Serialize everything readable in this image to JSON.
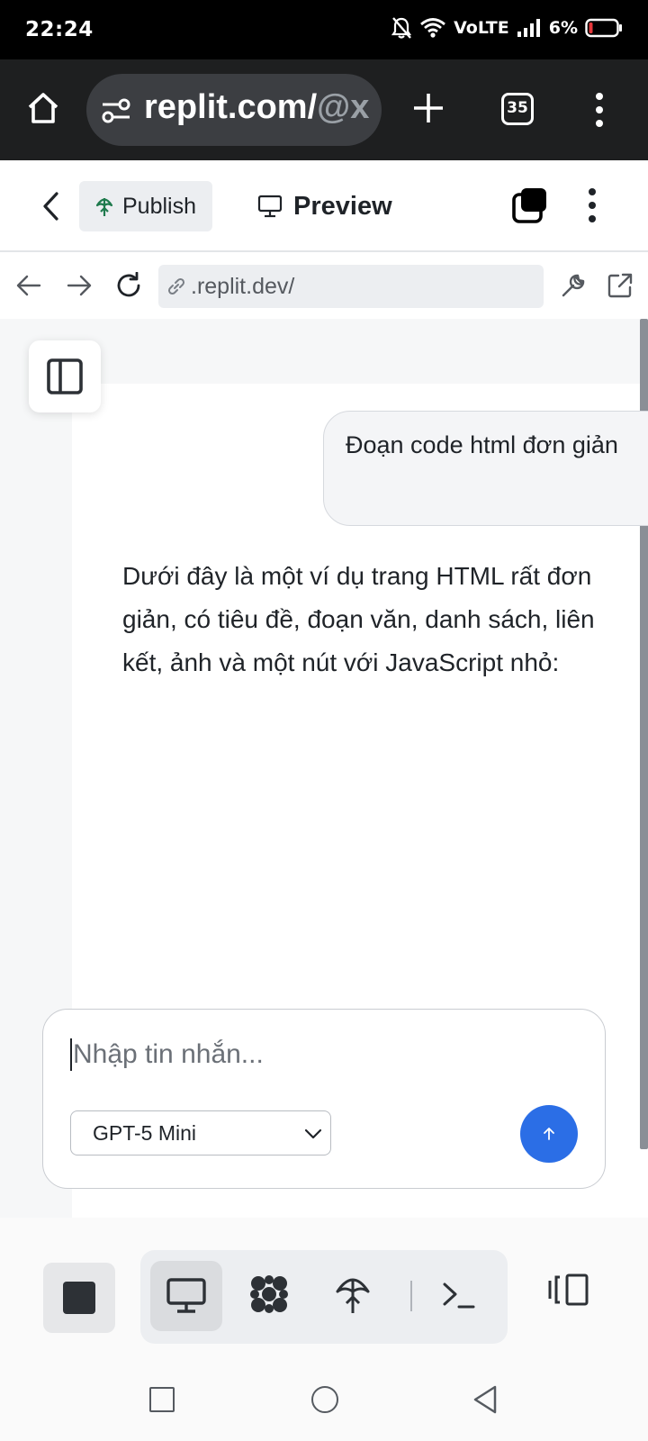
{
  "status_bar": {
    "time": "22:24",
    "network": "VoLTE",
    "battery": "6%"
  },
  "browser": {
    "url_main": "replit.com/",
    "url_dim": "@x",
    "tab_count": "35"
  },
  "app_header": {
    "publish_label": "Publish",
    "preview_label": "Preview"
  },
  "preview_nav": {
    "url": ".replit.dev/"
  },
  "chat": {
    "user_message": "Đoạn code html đơn giản",
    "assistant_message": "Dưới đây là một ví dụ trang HTML rất đơn giản, có tiêu đề, đoạn văn, danh sách, liên kết, ảnh và một nút với JavaScript nhỏ:",
    "input_placeholder": "Nhập tin nhắn...",
    "model_selected": "GPT-5 Mini"
  },
  "colors": {
    "accent": "#2b6ee6",
    "publish_icon": "#1f7a4d"
  },
  "icons": {
    "bottom_toolbar": [
      "stop-icon",
      "monitor-icon",
      "agent-icon",
      "deploy-icon",
      "shell-icon",
      "panes-icon"
    ]
  }
}
